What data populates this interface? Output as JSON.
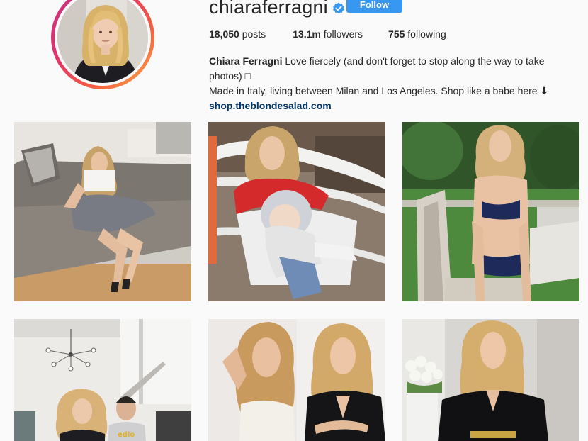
{
  "profile": {
    "username": "chiaraferragni",
    "verified": true,
    "follow_label": "Follow",
    "stats": [
      {
        "num": "18,050",
        "label": "posts"
      },
      {
        "num": "13.1m",
        "label": "followers"
      },
      {
        "num": "755",
        "label": "following"
      }
    ],
    "bio": {
      "full_name": "Chiara Ferragni",
      "line1": "Love fiercely (and don't forget to stop along the way to take photos) ",
      "line1_glyph": "□",
      "line2": "Made in Italy, living between Milan and Los Angeles. Shop like a babe here ⬇",
      "link": "shop.theblondesalad.com"
    }
  },
  "colors": {
    "accent": "#3897f0",
    "link": "#003569",
    "verified": "#3897f0",
    "background": "#fafafa"
  },
  "icons": {
    "verified": "verified-badge-icon"
  },
  "posts": [
    {
      "name": "post-sofa-photo"
    },
    {
      "name": "post-baby-photo"
    },
    {
      "name": "post-garden-bikini-photo"
    },
    {
      "name": "post-family-living-room-photo"
    },
    {
      "name": "post-two-portraits-photo"
    },
    {
      "name": "post-black-blazer-photo"
    }
  ]
}
